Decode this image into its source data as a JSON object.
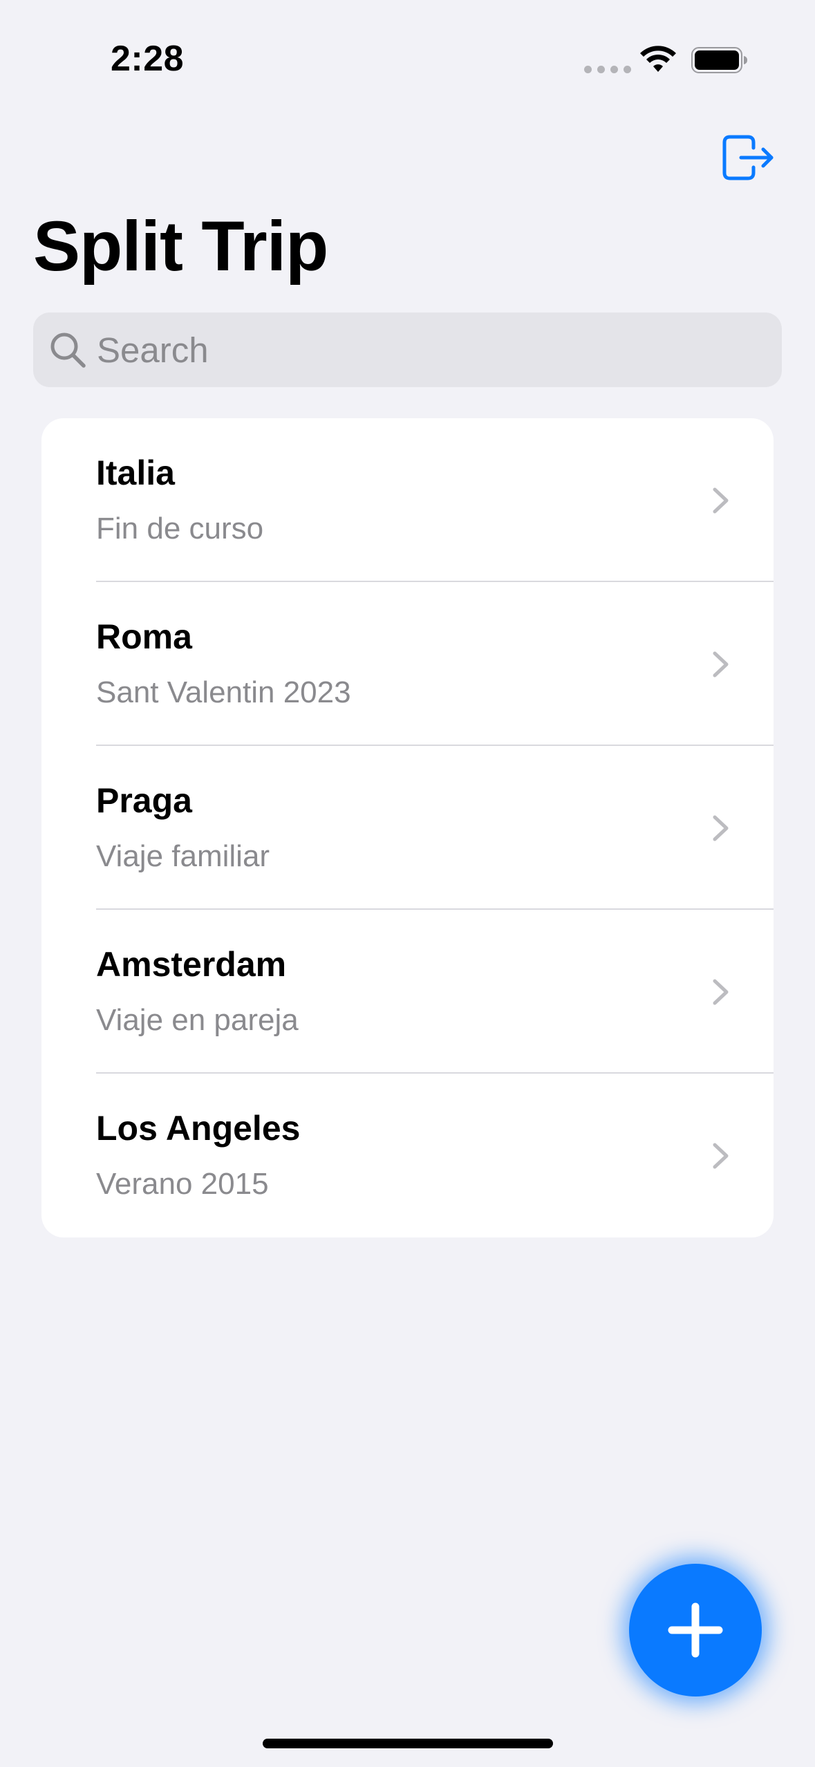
{
  "status_bar": {
    "time": "2:28"
  },
  "nav": {
    "title": "Split Trip",
    "logout_icon": "logout-icon"
  },
  "search": {
    "placeholder": "Search",
    "value": ""
  },
  "trips": [
    {
      "name": "Italia",
      "subtitle": "Fin de curso"
    },
    {
      "name": "Roma",
      "subtitle": "Sant Valentin 2023"
    },
    {
      "name": "Praga",
      "subtitle": "Viaje familiar"
    },
    {
      "name": "Amsterdam",
      "subtitle": "Viaje en pareja"
    },
    {
      "name": "Los Angeles",
      "subtitle": "Verano 2015"
    }
  ],
  "colors": {
    "accent": "#0A7AFF",
    "background": "#F2F2F7",
    "secondary_text": "#8A8A8E"
  }
}
